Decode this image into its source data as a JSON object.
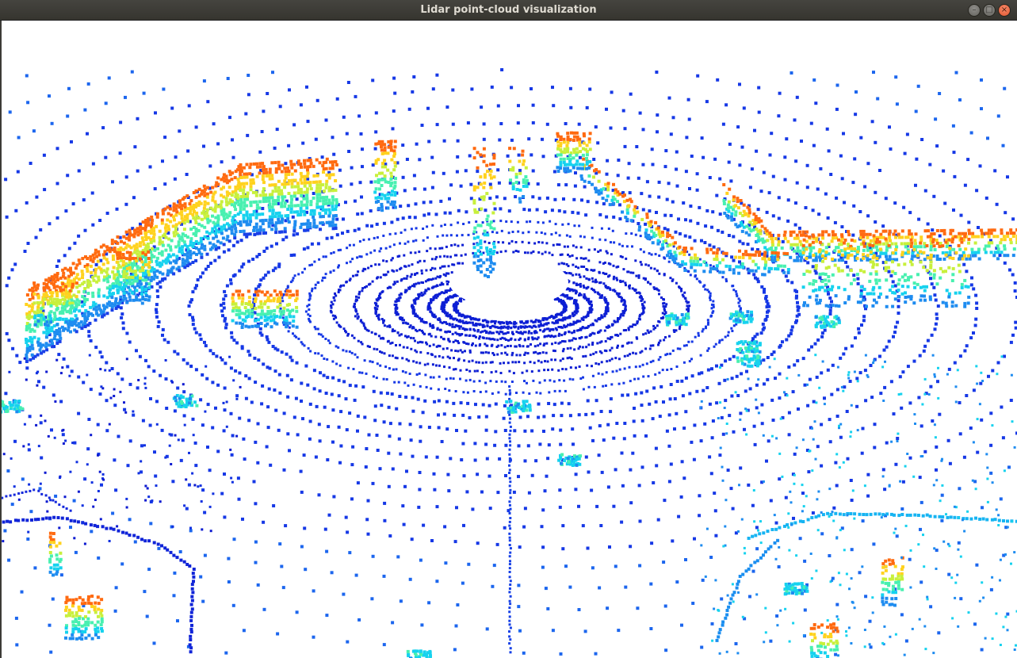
{
  "window": {
    "title": "Lidar point-cloud visualization",
    "buttons": {
      "minimize_icon": "minimize-icon",
      "maximize_icon": "maximize-icon",
      "close_icon": "close-icon",
      "minimize_glyph": "–",
      "maximize_glyph": "□",
      "close_glyph": "×"
    }
  },
  "viewer": {
    "background": "#ffffff",
    "colormap": [
      "#0a12c8",
      "#1a40e8",
      "#1e8cf0",
      "#16d2ee",
      "#48f0b0",
      "#c8f03c",
      "#ffd21e",
      "#ff6a10",
      "#e41a0a"
    ],
    "colormap_name": "jet (height)"
  }
}
